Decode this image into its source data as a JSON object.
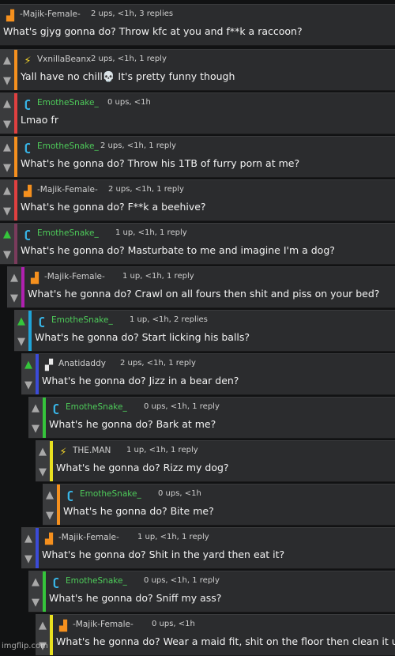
{
  "colors": {
    "background": "#111213",
    "card": "#2b2c2e",
    "upvote_active": "#35c53b",
    "username_green": "#4ecb5a",
    "username_gray": "#cfcfcf"
  },
  "comments": [
    {
      "username": "-Majik-Female-",
      "meta": "2 ups, <1h, 3 replies",
      "text": "What's gjyg gonna do? Throw kfc at you and f**k a raccoon?",
      "avatar_icon": "orange-chair-icon",
      "bar_color": "#2b2c2e",
      "up_active": false
    },
    {
      "username": "VxnillaBeanx",
      "meta": "2 ups, <1h, 1 reply",
      "text": "Yall have no chill💀 It's pretty funny though",
      "avatar_icon": "lightning-icon",
      "bar_color": "#f5901e",
      "up_active": false
    },
    {
      "username": "EmotheSnake_",
      "meta": "0 ups, <1h",
      "text": "Lmao fr",
      "avatar_icon": "blue-snake-icon",
      "bar_color": "#e04040",
      "up_active": false
    },
    {
      "username": "EmotheSnake_",
      "meta": "2 ups, <1h, 1 reply",
      "text": "What's he gonna do? Throw his 1TB of furry porn at me?",
      "avatar_icon": "blue-snake-icon",
      "bar_color": "#f5901e",
      "up_active": false
    },
    {
      "username": "-Majik-Female-",
      "meta": "2 ups, <1h, 1 reply",
      "text": "What's he gonna do? F**k a beehive?",
      "avatar_icon": "orange-chair-icon",
      "bar_color": "#e04040",
      "up_active": false
    },
    {
      "username": "EmotheSnake_",
      "meta": "1 up, <1h, 1 reply",
      "text": "What's he gonna do? Masturbate to me and imagine I'm a dog?",
      "avatar_icon": "blue-snake-icon",
      "bar_color": "#7a3b5c",
      "up_active": true
    },
    {
      "username": "-Majik-Female-",
      "meta": "1 up, <1h, 1 reply",
      "text": "What's he gonna do? Crawl on all fours then shit and piss on your bed?",
      "avatar_icon": "orange-chair-icon",
      "bar_color": "#b020b0",
      "up_active": false
    },
    {
      "username": "EmotheSnake_",
      "meta": "1 up, <1h, 2 replies",
      "text": "What's he gonna do? Start licking his balls?",
      "avatar_icon": "blue-snake-icon",
      "bar_color": "#1fa4d8",
      "up_active": true
    },
    {
      "username": "Anatidaddy",
      "meta": "2 ups, <1h, 1 reply",
      "text": "What's he gonna do? Jizz in a bear den?",
      "avatar_icon": "white-duck-icon",
      "bar_color": "#3b4bd8",
      "up_active": true
    },
    {
      "username": "EmotheSnake_",
      "meta": "0 ups, <1h, 1 reply",
      "text": "What's he gonna do? Bark at me?",
      "avatar_icon": "blue-snake-icon",
      "bar_color": "#35c53b",
      "up_active": false
    },
    {
      "username": "THE.MAN",
      "meta": "1 up, <1h, 1 reply",
      "text": "What's he gonna do? Rizz my dog?",
      "avatar_icon": "lightning-icon",
      "bar_color": "#e8e020",
      "up_active": false
    },
    {
      "username": "EmotheSnake_",
      "meta": "0 ups, <1h",
      "text": "What's he gonna do? Bite me?",
      "avatar_icon": "blue-snake-icon",
      "bar_color": "#f5901e",
      "up_active": false
    },
    {
      "username": "-Majik-Female-",
      "meta": "1 up, <1h, 1 reply",
      "text": "What's he gonna do? Shit in the yard then eat it?",
      "avatar_icon": "orange-chair-icon",
      "bar_color": "#3b4bd8",
      "up_active": false
    },
    {
      "username": "EmotheSnake_",
      "meta": "0 ups, <1h, 1 reply",
      "text": "What's he gonna do? Sniff my ass?",
      "avatar_icon": "blue-snake-icon",
      "bar_color": "#35c53b",
      "up_active": false
    },
    {
      "username": "-Majik-Female-",
      "meta": "0 ups, <1h",
      "text": "What's he gonna do? Wear a maid fit, shit on the floor then clean it up",
      "avatar_icon": "orange-chair-icon",
      "bar_color": "#e8e020",
      "up_active": false
    }
  ],
  "watermark": "imgflip.com"
}
